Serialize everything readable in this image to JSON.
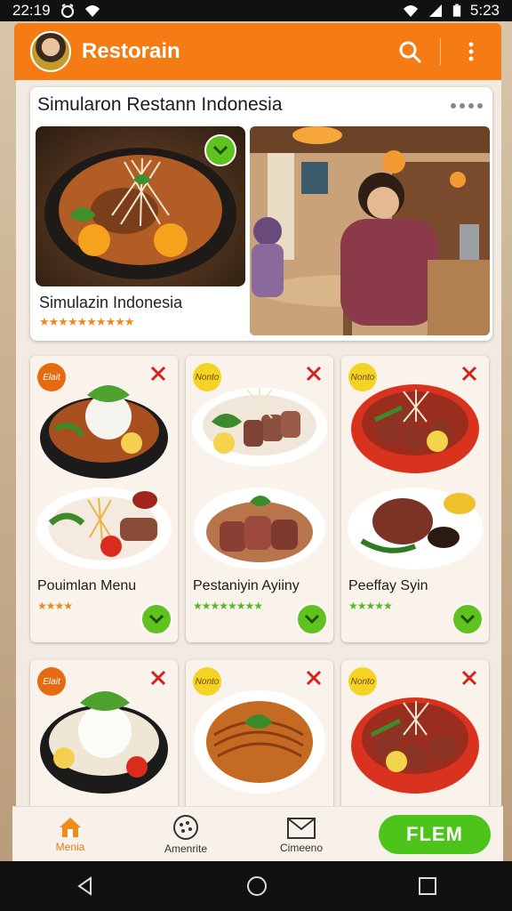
{
  "status_bar": {
    "time": "22:19",
    "battery": "5:23"
  },
  "app_bar": {
    "title": "Restorain"
  },
  "featured": {
    "header": "Simularon Restann Indonesia",
    "title": "Simulazin  Indonesia",
    "rating": "★★★★★★★★★★"
  },
  "menu_cards": [
    {
      "tag": "Elait",
      "title": "Pouimlan Menu",
      "rating": "★★★★"
    },
    {
      "tag": "Nonto",
      "title": "Pestaniyin Ayiiny",
      "rating": "★★★★★★★★"
    },
    {
      "tag": "Nonto",
      "title": "Peeffay Syin",
      "rating": "★★★★★"
    },
    {
      "tag": "Elait",
      "title": "",
      "rating": ""
    },
    {
      "tag": "Nonto",
      "title": "",
      "rating": ""
    },
    {
      "tag": "Nonto",
      "title": "",
      "rating": ""
    }
  ],
  "bottom_nav": {
    "items": [
      {
        "label": "Menia"
      },
      {
        "label": "Amenrite"
      },
      {
        "label": "Cimeeno"
      }
    ],
    "cta_label": "FLEM"
  },
  "colors": {
    "brand": "#f57c14",
    "accent_green": "#5fc21f"
  }
}
